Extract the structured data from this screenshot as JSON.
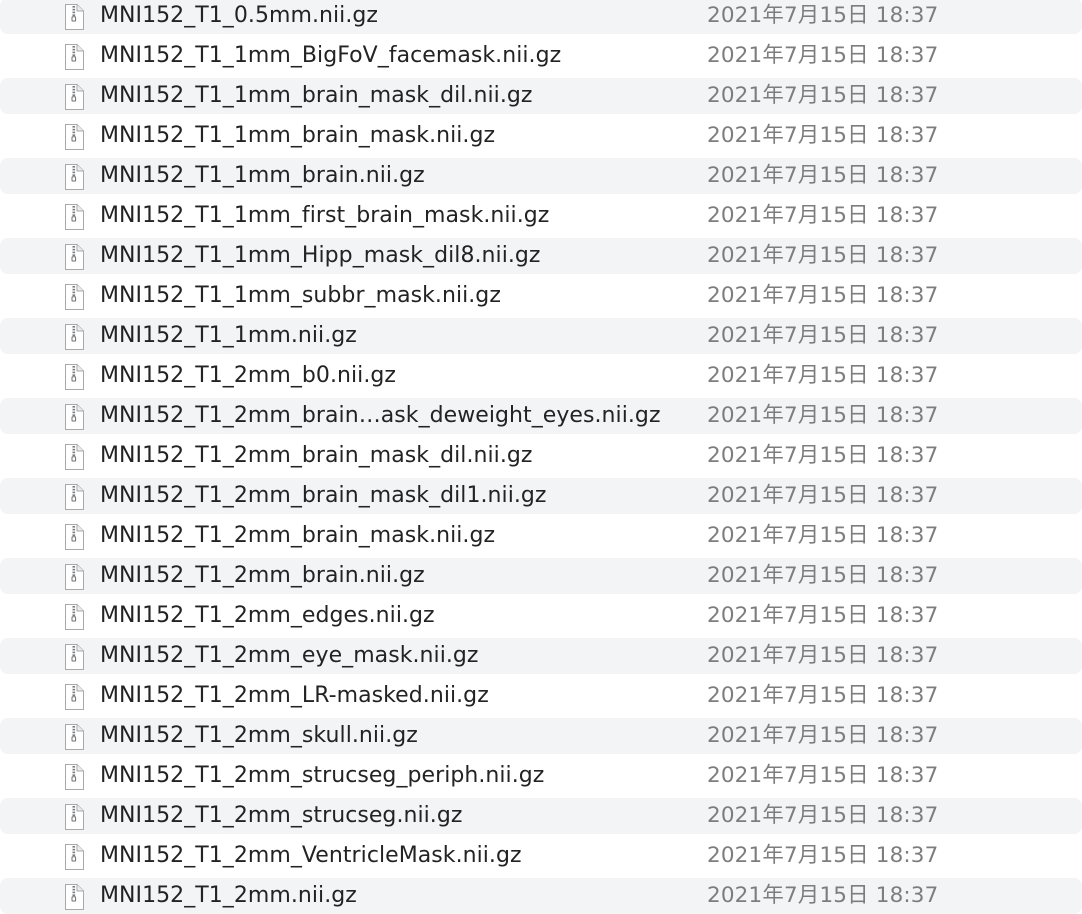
{
  "colors": {
    "background": "#ffffff",
    "stripe": "#f3f4f5",
    "name_text": "#232323",
    "date_text": "#7d7d7d"
  },
  "file_icon": "document-icon",
  "files": [
    {
      "name": "MNI152_T1_0.5mm.nii.gz",
      "date": "2021年7月15日 18:37"
    },
    {
      "name": "MNI152_T1_1mm_BigFoV_facemask.nii.gz",
      "date": "2021年7月15日 18:37"
    },
    {
      "name": "MNI152_T1_1mm_brain_mask_dil.nii.gz",
      "date": "2021年7月15日 18:37"
    },
    {
      "name": "MNI152_T1_1mm_brain_mask.nii.gz",
      "date": "2021年7月15日 18:37"
    },
    {
      "name": "MNI152_T1_1mm_brain.nii.gz",
      "date": "2021年7月15日 18:37"
    },
    {
      "name": "MNI152_T1_1mm_first_brain_mask.nii.gz",
      "date": "2021年7月15日 18:37"
    },
    {
      "name": "MNI152_T1_1mm_Hipp_mask_dil8.nii.gz",
      "date": "2021年7月15日 18:37"
    },
    {
      "name": "MNI152_T1_1mm_subbr_mask.nii.gz",
      "date": "2021年7月15日 18:37"
    },
    {
      "name": "MNI152_T1_1mm.nii.gz",
      "date": "2021年7月15日 18:37"
    },
    {
      "name": "MNI152_T1_2mm_b0.nii.gz",
      "date": "2021年7月15日 18:37"
    },
    {
      "name": "MNI152_T1_2mm_brain…ask_deweight_eyes.nii.gz",
      "date": "2021年7月15日 18:37"
    },
    {
      "name": "MNI152_T1_2mm_brain_mask_dil.nii.gz",
      "date": "2021年7月15日 18:37"
    },
    {
      "name": "MNI152_T1_2mm_brain_mask_dil1.nii.gz",
      "date": "2021年7月15日 18:37"
    },
    {
      "name": "MNI152_T1_2mm_brain_mask.nii.gz",
      "date": "2021年7月15日 18:37"
    },
    {
      "name": "MNI152_T1_2mm_brain.nii.gz",
      "date": "2021年7月15日 18:37"
    },
    {
      "name": "MNI152_T1_2mm_edges.nii.gz",
      "date": "2021年7月15日 18:37"
    },
    {
      "name": "MNI152_T1_2mm_eye_mask.nii.gz",
      "date": "2021年7月15日 18:37"
    },
    {
      "name": "MNI152_T1_2mm_LR-masked.nii.gz",
      "date": "2021年7月15日 18:37"
    },
    {
      "name": "MNI152_T1_2mm_skull.nii.gz",
      "date": "2021年7月15日 18:37"
    },
    {
      "name": "MNI152_T1_2mm_strucseg_periph.nii.gz",
      "date": "2021年7月15日 18:37"
    },
    {
      "name": "MNI152_T1_2mm_strucseg.nii.gz",
      "date": "2021年7月15日 18:37"
    },
    {
      "name": "MNI152_T1_2mm_VentricleMask.nii.gz",
      "date": "2021年7月15日 18:37"
    },
    {
      "name": "MNI152_T1_2mm.nii.gz",
      "date": "2021年7月15日 18:37"
    }
  ]
}
